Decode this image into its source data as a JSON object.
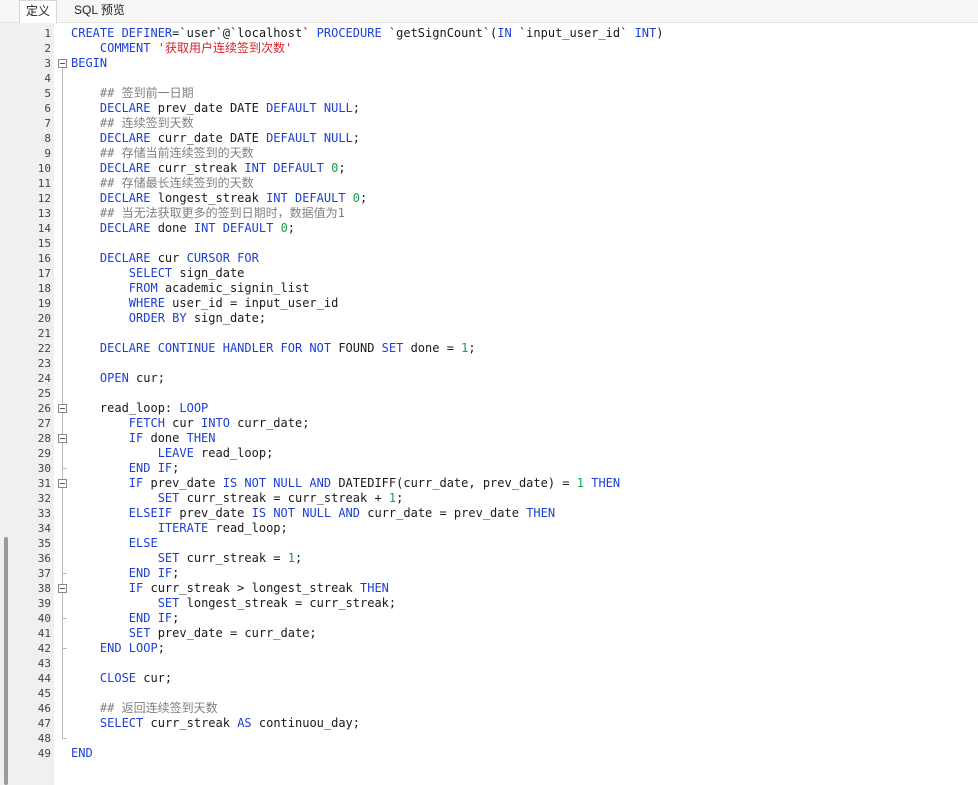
{
  "tabs": [
    {
      "label": "定义",
      "active": true
    },
    {
      "label": "SQL 预览",
      "active": false
    }
  ],
  "colors": {
    "keyword": "#1d3fd8",
    "string": "#d8232a",
    "number": "#13a24a",
    "comment": "#808080",
    "text": "#1a1a1a"
  },
  "lines": [
    [
      [
        "k",
        "CREATE DEFINER"
      ],
      [
        "t",
        "=`user`@`localhost` "
      ],
      [
        "k",
        "PROCEDURE"
      ],
      [
        "t",
        " `getSignCount`("
      ],
      [
        "k",
        "IN"
      ],
      [
        "t",
        " `input_user_id` "
      ],
      [
        "k",
        "INT"
      ],
      [
        "t",
        ")"
      ]
    ],
    [
      [
        "t",
        "    "
      ],
      [
        "k",
        "COMMENT"
      ],
      [
        "t",
        " "
      ],
      [
        "s",
        "'获取用户连续签到次数'"
      ]
    ],
    [
      [
        "k",
        "BEGIN"
      ]
    ],
    [],
    [
      [
        "t",
        "    "
      ],
      [
        "c",
        "## 签到前一日期"
      ]
    ],
    [
      [
        "t",
        "    "
      ],
      [
        "k",
        "DECLARE"
      ],
      [
        "t",
        " prev_date DATE "
      ],
      [
        "k",
        "DEFAULT NULL"
      ],
      [
        "t",
        ";"
      ]
    ],
    [
      [
        "t",
        "    "
      ],
      [
        "c",
        "## 连续签到天数"
      ]
    ],
    [
      [
        "t",
        "    "
      ],
      [
        "k",
        "DECLARE"
      ],
      [
        "t",
        " curr_date DATE "
      ],
      [
        "k",
        "DEFAULT NULL"
      ],
      [
        "t",
        ";"
      ]
    ],
    [
      [
        "t",
        "    "
      ],
      [
        "c",
        "## 存储当前连续签到的天数"
      ]
    ],
    [
      [
        "t",
        "    "
      ],
      [
        "k",
        "DECLARE"
      ],
      [
        "t",
        " curr_streak "
      ],
      [
        "k",
        "INT DEFAULT"
      ],
      [
        "t",
        " "
      ],
      [
        "n",
        "0"
      ],
      [
        "t",
        ";"
      ]
    ],
    [
      [
        "t",
        "    "
      ],
      [
        "c",
        "## 存储最长连续签到的天数"
      ]
    ],
    [
      [
        "t",
        "    "
      ],
      [
        "k",
        "DECLARE"
      ],
      [
        "t",
        " longest_streak "
      ],
      [
        "k",
        "INT DEFAULT"
      ],
      [
        "t",
        " "
      ],
      [
        "n",
        "0"
      ],
      [
        "t",
        ";"
      ]
    ],
    [
      [
        "t",
        "    "
      ],
      [
        "c",
        "## 当无法获取更多的签到日期时，数据值为1"
      ]
    ],
    [
      [
        "t",
        "    "
      ],
      [
        "k",
        "DECLARE"
      ],
      [
        "t",
        " done "
      ],
      [
        "k",
        "INT DEFAULT"
      ],
      [
        "t",
        " "
      ],
      [
        "n",
        "0"
      ],
      [
        "t",
        ";"
      ]
    ],
    [],
    [
      [
        "t",
        "    "
      ],
      [
        "k",
        "DECLARE"
      ],
      [
        "t",
        " cur "
      ],
      [
        "k",
        "CURSOR FOR"
      ]
    ],
    [
      [
        "t",
        "        "
      ],
      [
        "k",
        "SELECT"
      ],
      [
        "t",
        " sign_date"
      ]
    ],
    [
      [
        "t",
        "        "
      ],
      [
        "k",
        "FROM"
      ],
      [
        "t",
        " academic_signin_list"
      ]
    ],
    [
      [
        "t",
        "        "
      ],
      [
        "k",
        "WHERE"
      ],
      [
        "t",
        " user_id = input_user_id"
      ]
    ],
    [
      [
        "t",
        "        "
      ],
      [
        "k",
        "ORDER BY"
      ],
      [
        "t",
        " sign_date;"
      ]
    ],
    [],
    [
      [
        "t",
        "    "
      ],
      [
        "k",
        "DECLARE CONTINUE HANDLER FOR NOT"
      ],
      [
        "t",
        " FOUND "
      ],
      [
        "k",
        "SET"
      ],
      [
        "t",
        " done = "
      ],
      [
        "n",
        "1"
      ],
      [
        "t",
        ";"
      ]
    ],
    [],
    [
      [
        "t",
        "    "
      ],
      [
        "k",
        "OPEN"
      ],
      [
        "t",
        " cur;"
      ]
    ],
    [],
    [
      [
        "t",
        "    read_loop: "
      ],
      [
        "k",
        "LOOP"
      ]
    ],
    [
      [
        "t",
        "        "
      ],
      [
        "k",
        "FETCH"
      ],
      [
        "t",
        " cur "
      ],
      [
        "k",
        "INTO"
      ],
      [
        "t",
        " curr_date;"
      ]
    ],
    [
      [
        "t",
        "        "
      ],
      [
        "k",
        "IF"
      ],
      [
        "t",
        " done "
      ],
      [
        "k",
        "THEN"
      ]
    ],
    [
      [
        "t",
        "            "
      ],
      [
        "k",
        "LEAVE"
      ],
      [
        "t",
        " read_loop;"
      ]
    ],
    [
      [
        "t",
        "        "
      ],
      [
        "k",
        "END IF"
      ],
      [
        "t",
        ";"
      ]
    ],
    [
      [
        "t",
        "        "
      ],
      [
        "k",
        "IF"
      ],
      [
        "t",
        " prev_date "
      ],
      [
        "k",
        "IS NOT NULL AND"
      ],
      [
        "t",
        " DATEDIFF(curr_date, prev_date) = "
      ],
      [
        "n",
        "1"
      ],
      [
        "t",
        " "
      ],
      [
        "k",
        "THEN"
      ]
    ],
    [
      [
        "t",
        "            "
      ],
      [
        "k",
        "SET"
      ],
      [
        "t",
        " curr_streak = curr_streak + "
      ],
      [
        "n",
        "1"
      ],
      [
        "t",
        ";"
      ]
    ],
    [
      [
        "t",
        "        "
      ],
      [
        "k",
        "ELSEIF"
      ],
      [
        "t",
        " prev_date "
      ],
      [
        "k",
        "IS NOT NULL AND"
      ],
      [
        "t",
        " curr_date = prev_date "
      ],
      [
        "k",
        "THEN"
      ]
    ],
    [
      [
        "t",
        "            "
      ],
      [
        "k",
        "ITERATE"
      ],
      [
        "t",
        " read_loop;"
      ]
    ],
    [
      [
        "t",
        "        "
      ],
      [
        "k",
        "ELSE"
      ]
    ],
    [
      [
        "t",
        "            "
      ],
      [
        "k",
        "SET"
      ],
      [
        "t",
        " curr_streak = "
      ],
      [
        "n",
        "1"
      ],
      [
        "t",
        ";"
      ]
    ],
    [
      [
        "t",
        "        "
      ],
      [
        "k",
        "END IF"
      ],
      [
        "t",
        ";"
      ]
    ],
    [
      [
        "t",
        "        "
      ],
      [
        "k",
        "IF"
      ],
      [
        "t",
        " curr_streak > longest_streak "
      ],
      [
        "k",
        "THEN"
      ]
    ],
    [
      [
        "t",
        "            "
      ],
      [
        "k",
        "SET"
      ],
      [
        "t",
        " longest_streak = curr_streak;"
      ]
    ],
    [
      [
        "t",
        "        "
      ],
      [
        "k",
        "END IF"
      ],
      [
        "t",
        ";"
      ]
    ],
    [
      [
        "t",
        "        "
      ],
      [
        "k",
        "SET"
      ],
      [
        "t",
        " prev_date = curr_date;"
      ]
    ],
    [
      [
        "t",
        "    "
      ],
      [
        "k",
        "END LOOP"
      ],
      [
        "t",
        ";"
      ]
    ],
    [],
    [
      [
        "t",
        "    "
      ],
      [
        "k",
        "CLOSE"
      ],
      [
        "t",
        " cur;"
      ]
    ],
    [],
    [
      [
        "t",
        "    "
      ],
      [
        "c",
        "## 返回连续签到天数"
      ]
    ],
    [
      [
        "t",
        "    "
      ],
      [
        "k",
        "SELECT"
      ],
      [
        "t",
        " curr_streak "
      ],
      [
        "k",
        "AS"
      ],
      [
        "t",
        " continuou_day;"
      ]
    ],
    [],
    [
      [
        "k",
        "END"
      ]
    ]
  ],
  "line_numbers": [
    "1",
    "2",
    "3",
    "4",
    "5",
    "6",
    "7",
    "8",
    "9",
    "10",
    "11",
    "12",
    "13",
    "14",
    "15",
    "16",
    "17",
    "18",
    "19",
    "20",
    "21",
    "22",
    "23",
    "24",
    "25",
    "26",
    "27",
    "28",
    "29",
    "30",
    "31",
    "32",
    "33",
    "34",
    "35",
    "36",
    "37",
    "38",
    "39",
    "40",
    "41",
    "42",
    "43",
    "44",
    "45",
    "46",
    "47",
    "48",
    "49"
  ]
}
